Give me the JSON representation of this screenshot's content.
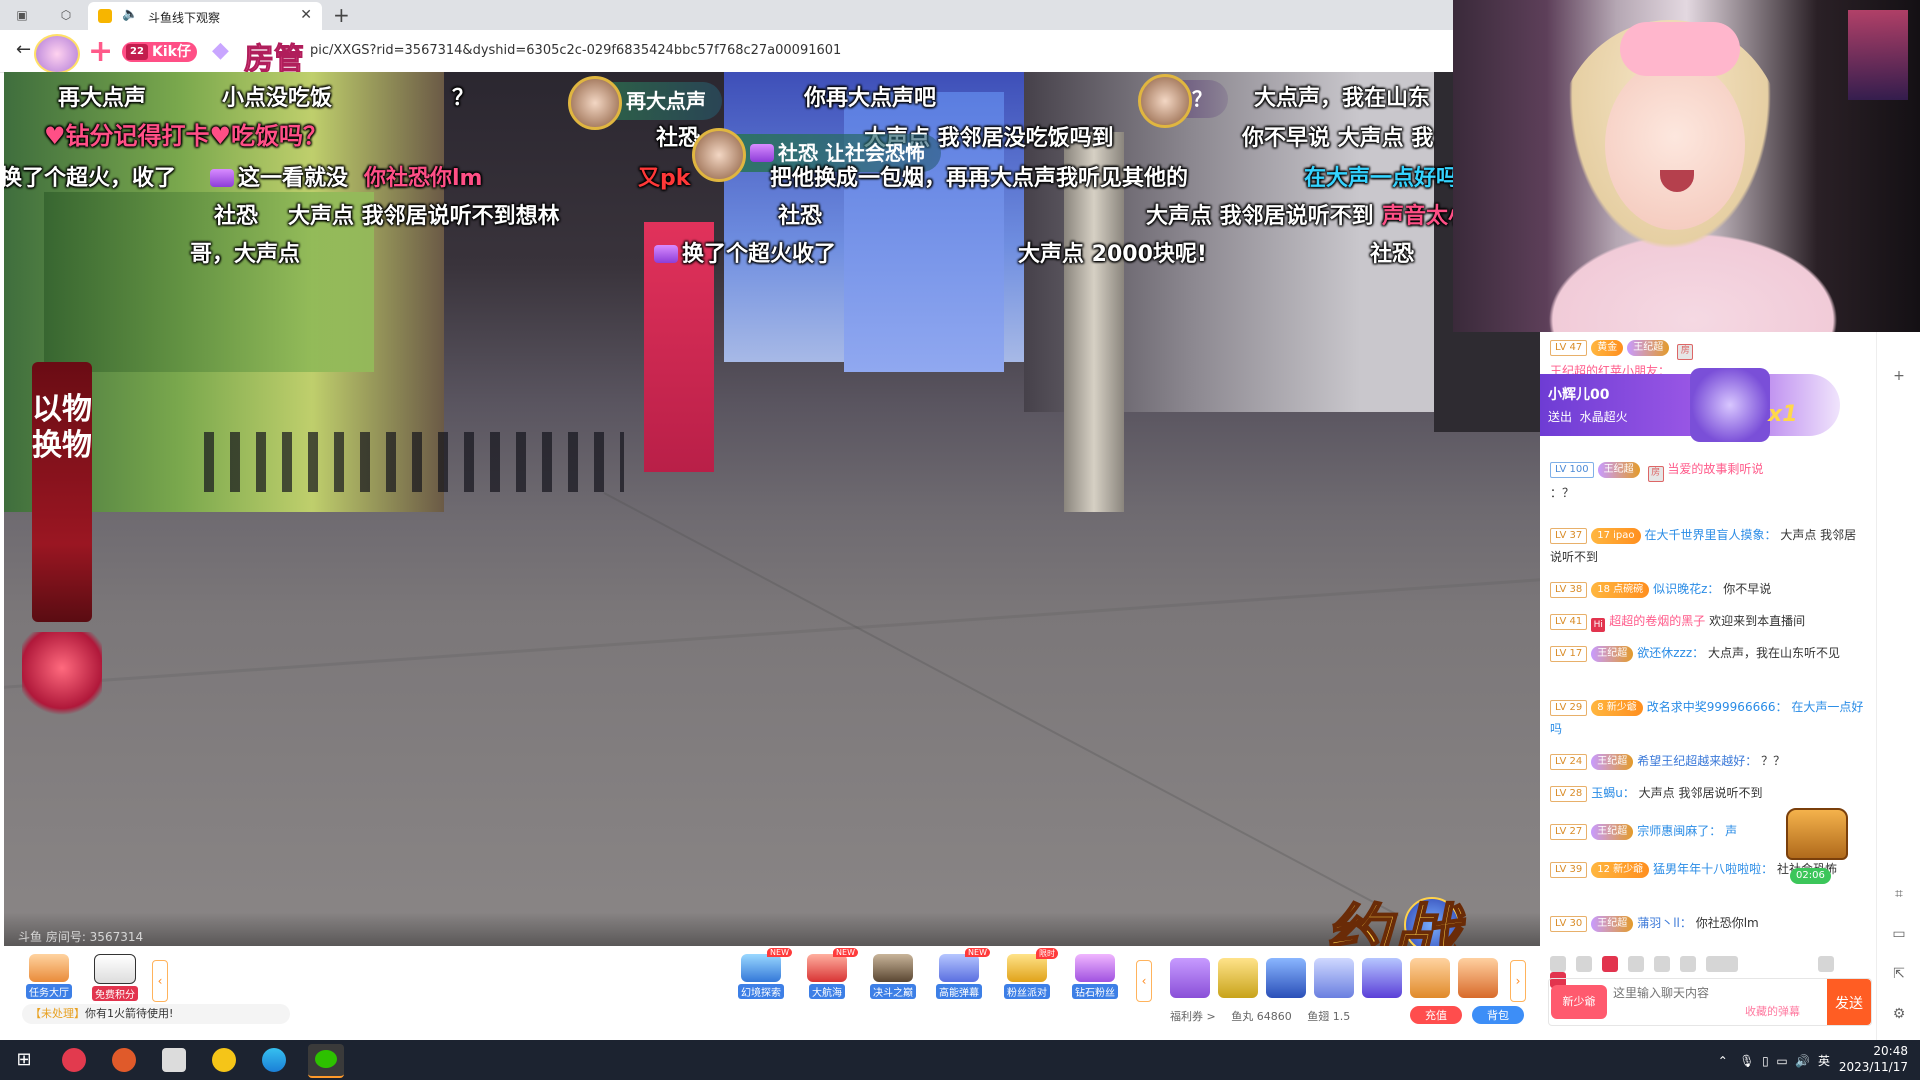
{
  "browser": {
    "tab_title": "斗鱼线下观察",
    "url": "pic/XXGS?rid=3567314&dyshid=6305c2c-029f6835424bbc57f768c27a00091601"
  },
  "room_manager_badge": {
    "name": "Kik仔",
    "level_tag": "22",
    "role": "房管",
    "plus": "+"
  },
  "stage": {
    "side_banner": "以物换物",
    "room_number_label": "斗鱼 房间号: 3567314",
    "event_logo": "约战"
  },
  "danmaku": [
    {
      "text": "再大点声",
      "style": "white"
    },
    {
      "text": "小点没吃饭",
      "style": "white"
    },
    {
      "text": "？",
      "style": "white"
    },
    {
      "text": "再大点声",
      "style": "pill"
    },
    {
      "text": "你再大点声吧",
      "style": "white"
    },
    {
      "text": "？",
      "style": "pill-light"
    },
    {
      "text": "大点声，我在山东",
      "style": "white"
    },
    {
      "text": "♥钻分记得打卡♥吃饭吗？",
      "style": "pink"
    },
    {
      "text": "社恐",
      "style": "white"
    },
    {
      "text": "大声点 我邻居没吃饭吗到",
      "style": "white"
    },
    {
      "text": "你不早说 大声点 我",
      "style": "white"
    },
    {
      "text": "换了个超火，收了",
      "style": "white"
    },
    {
      "text": "这一看就没",
      "style": "white"
    },
    {
      "text": "你社恐你lm",
      "style": "pink"
    },
    {
      "text": "又pk",
      "style": "red"
    },
    {
      "text": "社恐 让社会恐怖",
      "style": "pill"
    },
    {
      "text": "把他换成一包烟，再再大点声我听见其他的",
      "style": "white"
    },
    {
      "text": "在大声一点好吗",
      "style": "cyan"
    },
    {
      "text": "社恐",
      "style": "white"
    },
    {
      "text": "大声点 我邻居说听不到想林",
      "style": "white"
    },
    {
      "text": "社恐",
      "style": "white"
    },
    {
      "text": "大声点 我邻居说听不到",
      "style": "white"
    },
    {
      "text": "声音太小",
      "style": "pink"
    },
    {
      "text": "哥，大声点",
      "style": "white"
    },
    {
      "text": "换了个超火收了",
      "style": "white"
    },
    {
      "text": "大声点 2000块呢!",
      "style": "white"
    },
    {
      "text": "社恐",
      "style": "white"
    }
  ],
  "chat": {
    "gift_popup": {
      "name": "小辉儿00",
      "action": "送出",
      "gift": "水晶超火",
      "count": "x1"
    },
    "messages": [
      {
        "level": "LV 47",
        "fan": "黄金",
        "badge": "王纪超",
        "nick": "王纪超的红苹小朋友：",
        "text": "",
        "nick_style": "pink"
      },
      {
        "level": "LV 100",
        "badge": "王纪超",
        "nick": "当爱的故事剩听说",
        "text": "：？",
        "nick_style": "pink"
      },
      {
        "level": "LV 37",
        "fan": "17 ipao",
        "nick": "在大千世界里盲人摸象：",
        "text": "大声点 我邻居说听不到"
      },
      {
        "level": "LV 38",
        "fan": "18 点碗碗",
        "nick": "似识晚花z：",
        "text": "你不早说"
      },
      {
        "level": "LV 41",
        "nick": "超超的卷烟的黑子",
        "text": "欢迎来到本直播间",
        "nick_style": "pink"
      },
      {
        "level": "LV 17",
        "badge": "王纪超",
        "nick": "欲还休zzz：",
        "text": "大点声，我在山东听不见"
      },
      {
        "level": "LV 29",
        "fan": "8 新少爺",
        "nick": "改名求中奖999966666：",
        "text": "在大声一点好吗"
      },
      {
        "level": "LV 24",
        "badge": "王纪超",
        "nick": "希望王纪超越来越好：",
        "text": "？？"
      },
      {
        "level": "LV 28",
        "nick": "玉蝎u：",
        "text": "大声点 我邻居说听不到"
      },
      {
        "level": "LV 27",
        "badge": "王纪超",
        "nick": "宗师惠闽麻了：",
        "text": "声"
      },
      {
        "level": "LV 39",
        "fan": "12 新少爺",
        "nick": "猛男年年十八啦啦啦：",
        "text": "社社会恐怖"
      },
      {
        "level": "LV 30",
        "badge": "王纪超",
        "nick": "蒲羽丶ll：",
        "text": "你社恐你lm"
      }
    ],
    "timer": "02:06",
    "input_placeholder": "这里输入聊天内容",
    "fan_pill": "新少爺",
    "danmu_tag": "收藏的弹幕",
    "send_label": "发送"
  },
  "toolbar": {
    "left_buttons": [
      {
        "label": "任务大厅"
      },
      {
        "label": "免费积分"
      }
    ],
    "features": [
      {
        "label": "幻境探索",
        "tag": "NEW"
      },
      {
        "label": "大航海",
        "tag": "NEW"
      },
      {
        "label": "决斗之巅",
        "tag": ""
      },
      {
        "label": "高能弹幕",
        "tag": "NEW"
      },
      {
        "label": "粉丝派对",
        "tag": "限时"
      },
      {
        "label": "钻石粉丝",
        "tag": ""
      }
    ],
    "notice_prefix": "【未处理】",
    "notice_text": "你有1火箭待使用!",
    "status": {
      "welfare": "福利券 >",
      "fish_balls": "鱼丸 64860",
      "fish_wings": "鱼翅 1.5"
    },
    "recharge": "充值",
    "bag": "背包"
  },
  "taskbar": {
    "tray_lang": "英",
    "time": "20:48",
    "date": "2023/11/17"
  },
  "colors": {
    "accent": "#ff5d23",
    "danmaku_pink": "#ff4f86",
    "chat_nick_blue": "#2a8ce6",
    "taskbar": "#1c2330"
  }
}
